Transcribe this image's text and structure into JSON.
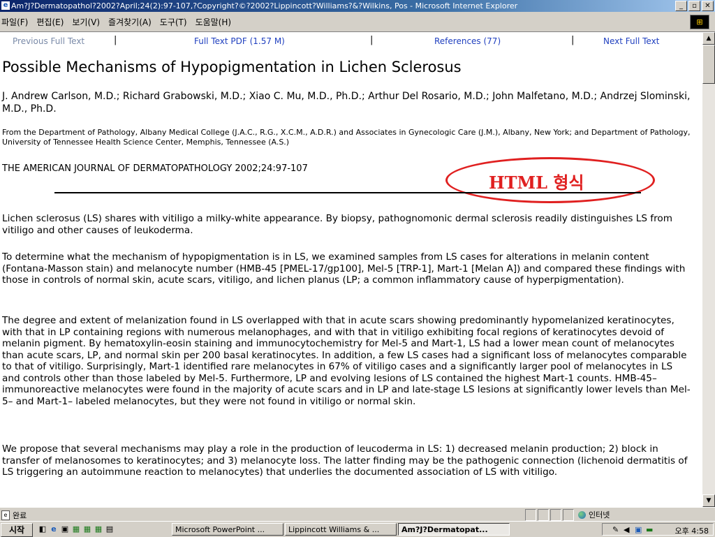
{
  "window": {
    "title": "Am?J?Dermatopathol?2002?April;24(2):97-107,?Copyright?©?2002?Lippincott?Williams?&?Wilkins, Pos - Microsoft Internet Explorer",
    "buttons": [
      "_",
      "▫",
      "✕"
    ]
  },
  "menu": {
    "items": [
      "파일(F)",
      "편집(E)",
      "보기(V)",
      "즐겨찾기(A)",
      "도구(T)",
      "도움말(H)"
    ]
  },
  "nav": {
    "previous": "Previous Full Text",
    "pdf": "Full Text PDF (1.57 M)",
    "references": "References (77)",
    "next": "Next Full Text",
    "separator": "|"
  },
  "article": {
    "title": "Possible Mechanisms of Hypopigmentation in Lichen Sclerosus",
    "authors": "J. Andrew Carlson, M.D.; Richard Grabowski, M.D.; Xiao C. Mu, M.D., Ph.D.; Arthur Del Rosario, M.D.; John Malfetano, M.D.; Andrzej Slominski, M.D., Ph.D.",
    "affiliation": "From the Department of Pathology, Albany Medical College (J.A.C., R.G., X.C.M., A.D.R.) and Associates in Gynecologic Care (J.M.), Albany, New York; and Department of Pathology, University of Tennessee Health Science Center, Memphis, Tennessee (A.S.)",
    "journal": "THE AMERICAN JOURNAL OF DERMATOPATHOLOGY 2002;24:97-107",
    "paragraphs": [
      "Lichen sclerosus (LS) shares with vitiligo a milky-white appearance. By biopsy, pathognomonic dermal sclerosis readily distinguishes LS from vitiligo and other causes of leukoderma.",
      "To determine what the mechanism of hypopigmentation is in LS, we examined samples from LS cases for alterations in melanin content (Fontana-Masson stain) and melanocyte number (HMB-45 [PMEL-17/gp100], Mel-5 [TRP-1], Mart-1 [Melan A]) and compared these findings with those in controls of normal skin, acute scars, vitiligo, and lichen planus (LP; a common inflammatory cause of hyperpigmentation).",
      "The degree and extent of melanization found in LS overlapped with that in acute scars showing predominantly hypomelanized keratinocytes, with that in LP containing regions with numerous melanophages, and with that in vitiligo exhibiting focal regions of keratinocytes devoid of melanin pigment. By hematoxylin-eosin staining and immunocytochemistry for Mel-5 and Mart-1, LS had a lower mean count of melanocytes than acute scars, LP, and normal skin per 200 basal keratinocytes. In addition, a few LS cases had a significant loss of melanocytes comparable to that of vitiligo. Surprisingly, Mart-1 identified rare melanocytes in 67% of vitiligo cases and a significantly larger pool of melanocytes in LS and controls other than those labeled by Mel-5. Furthermore, LP and evolving lesions of LS contained the highest Mart-1 counts. HMB-45–immunoreactive melanocytes were found in the majority of acute scars and in LP and late-stage LS lesions at significantly lower levels than Mel-5– and Mart-1– labeled melanocytes, but they were not found in vitiligo or normal skin.",
      "We propose that several mechanisms may play a role in the production of leucoderma in LS: 1) decreased melanin production; 2) block in transfer of melanosomes to keratinocytes; and 3) melanocyte loss. The latter finding may be the pathogenic connection (lichenoid dermatitis of LS triggering an autoimmune reaction to melanocytes) that underlies the documented association of LS with vitiligo."
    ]
  },
  "annotation": {
    "text": "HTML 형식",
    "color": "#e02020"
  },
  "status": {
    "text": "완료",
    "zone": "인터넷"
  },
  "taskbar": {
    "start": "시작",
    "tasks": [
      "Microsoft PowerPoint ...",
      "Lippincott Williams & ...",
      "Am?J?Dermatopat..."
    ],
    "clock": "오후 4:58"
  }
}
